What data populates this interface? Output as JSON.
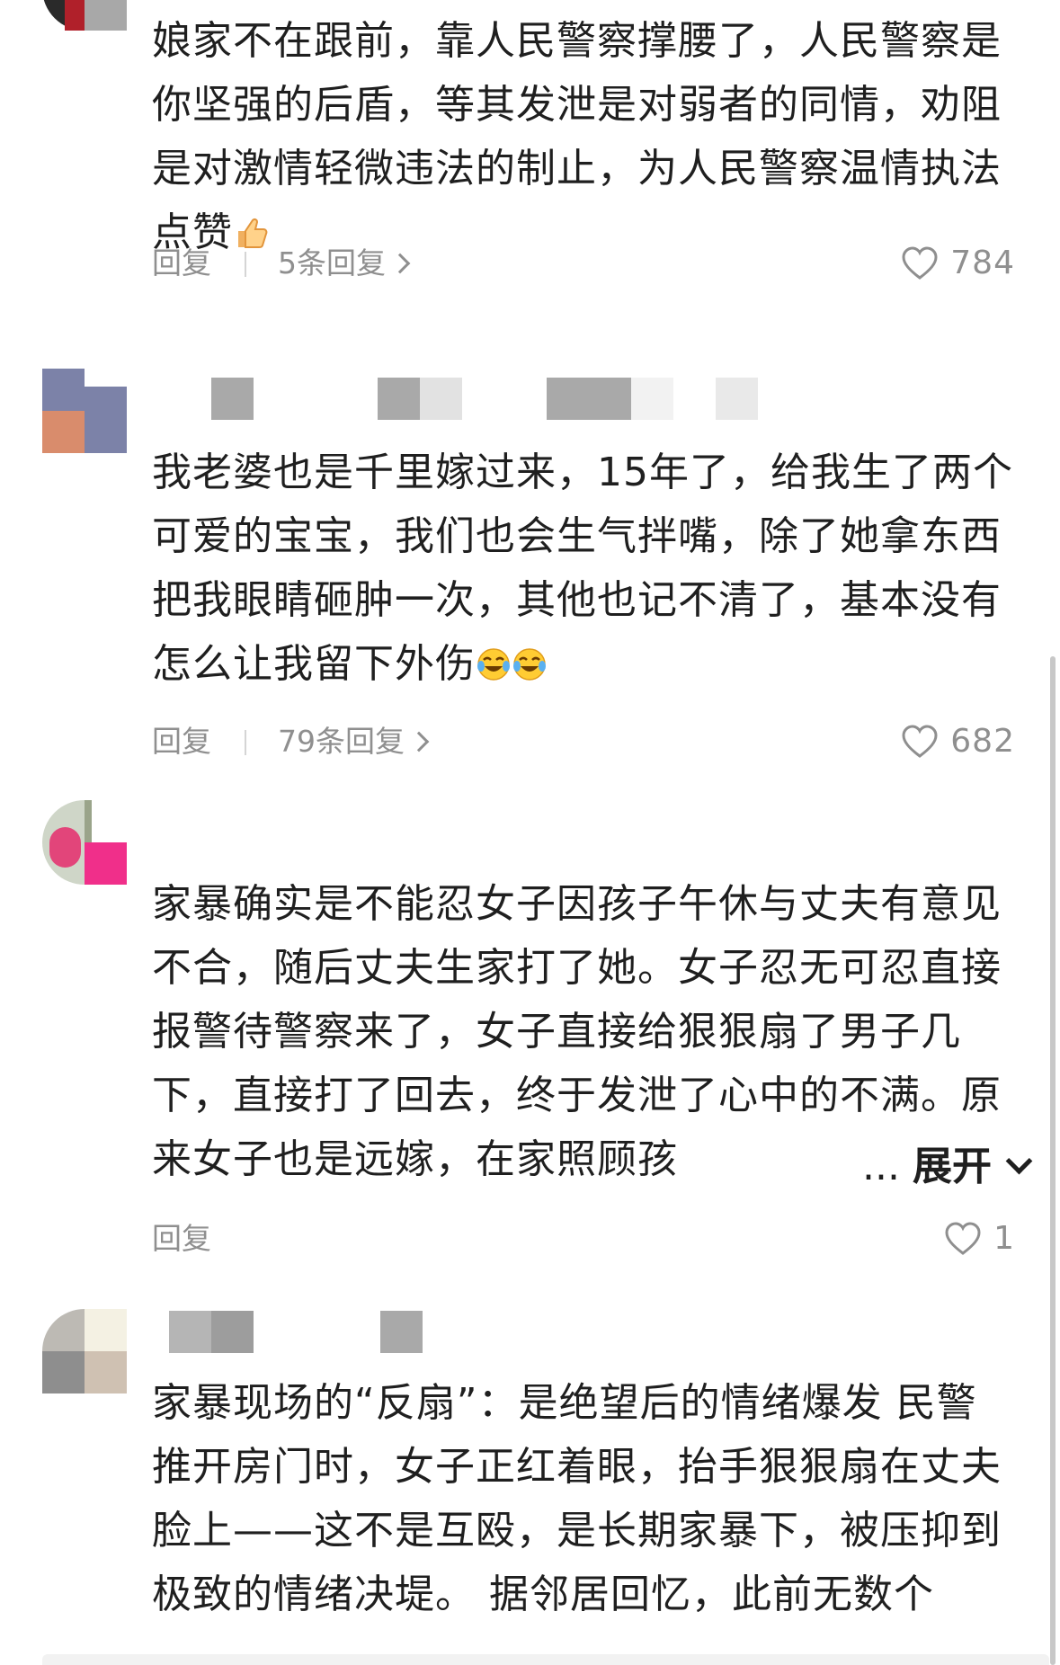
{
  "comments": [
    {
      "text": "娘家不在跟前，靠人民警察撑腰了，人民警察是你坚强的后盾，等其发泄是对弱者的同情，劝阻是对激情轻微违法的制止，为人民警察温情执法点赞",
      "emoji": "thumbs-up",
      "reply_label": "回复",
      "thread_label": "5条回复",
      "likes": "784"
    },
    {
      "text": "我老婆也是千里嫁过来，15年了，给我生了两个可爱的宝宝，我们也会生气拌嘴，除了她拿东西把我眼睛砸肿一次，其他也记不清了，基本没有怎么让我留下外伤",
      "emoji": "tears-of-joy",
      "reply_label": "回复",
      "thread_label": "79条回复",
      "likes": "682"
    },
    {
      "text": "家暴确实是不能忍女子因孩子午休与丈夫有意见不合，随后丈夫生家打了她。女子忍无可忍直接报警待警察来了，女子直接给狠狠扇了男子几下，直接打了回去，终于发泄了心中的不满。原来女子也是远嫁，在家照顾孩",
      "ellipsis": "...",
      "expand_label": "展开",
      "reply_label": "回复",
      "likes": "1"
    },
    {
      "text": "家暴现场的“反扇”：是绝望后的情绪爆发 民警推开房门时，女子正红着眼，抬手狠狠扇在丈夫脸上——这不是互殴，是长期家暴下，被压抑到极致的情绪决堤。 据邻居回忆，此前无数个"
    }
  ],
  "icons": {
    "like": "heart-outline-icon",
    "thread": "chevron-right-icon",
    "expand": "chevron-down-icon"
  },
  "colors": {
    "text": "#1f1f1f",
    "secondary": "#8f8f8f",
    "separator": "#d5d5d5"
  }
}
